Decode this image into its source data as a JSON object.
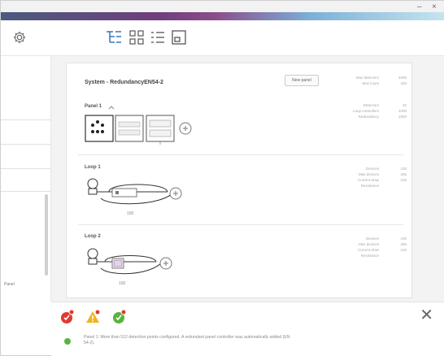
{
  "colors": {
    "accent": "#2b6cb0",
    "error": "#e03a2f",
    "warning": "#f0b41c",
    "ok": "#58b53f"
  },
  "window": {
    "minimize_label": "–",
    "close_label": "×"
  },
  "toolbar": {
    "views": [
      "tree-view-icon",
      "grid-view-icon",
      "list-view-icon",
      "panel-view-icon"
    ]
  },
  "sidebar": {
    "footer_text": "Panel"
  },
  "system": {
    "title": "System - RedundancyEN54-2",
    "new_panel_button": "New panel",
    "meta_right_top": [
      "Max detectors",
      "Max loops"
    ],
    "meta_right_values": [
      "4000",
      "320"
    ]
  },
  "panel1": {
    "label": "Panel 1",
    "meta_labels": [
      "Detectors",
      "Loop controllers",
      "Redundancy"
    ],
    "meta_values": [
      "32",
      "1000",
      "1000"
    ]
  },
  "loop1": {
    "label": "Loop 1",
    "device_caption": "100",
    "meta_labels": [
      "Devices",
      "Max devices",
      "Current draw",
      "Resistance"
    ],
    "meta_values": [
      "100",
      "255",
      "100",
      ""
    ]
  },
  "loop2": {
    "label": "Loop 2",
    "device_caption": "100",
    "meta_labels": [
      "Devices",
      "Max devices",
      "Current draw",
      "Resistance"
    ],
    "meta_values": [
      "100",
      "255",
      "100",
      ""
    ]
  },
  "messages": {
    "close_label": "✕",
    "items": [
      {
        "status": "ok",
        "text": "Panel 1: More than 512 detection points configured. A redundant panel controller was automatically added (EN 54-2)."
      }
    ]
  }
}
